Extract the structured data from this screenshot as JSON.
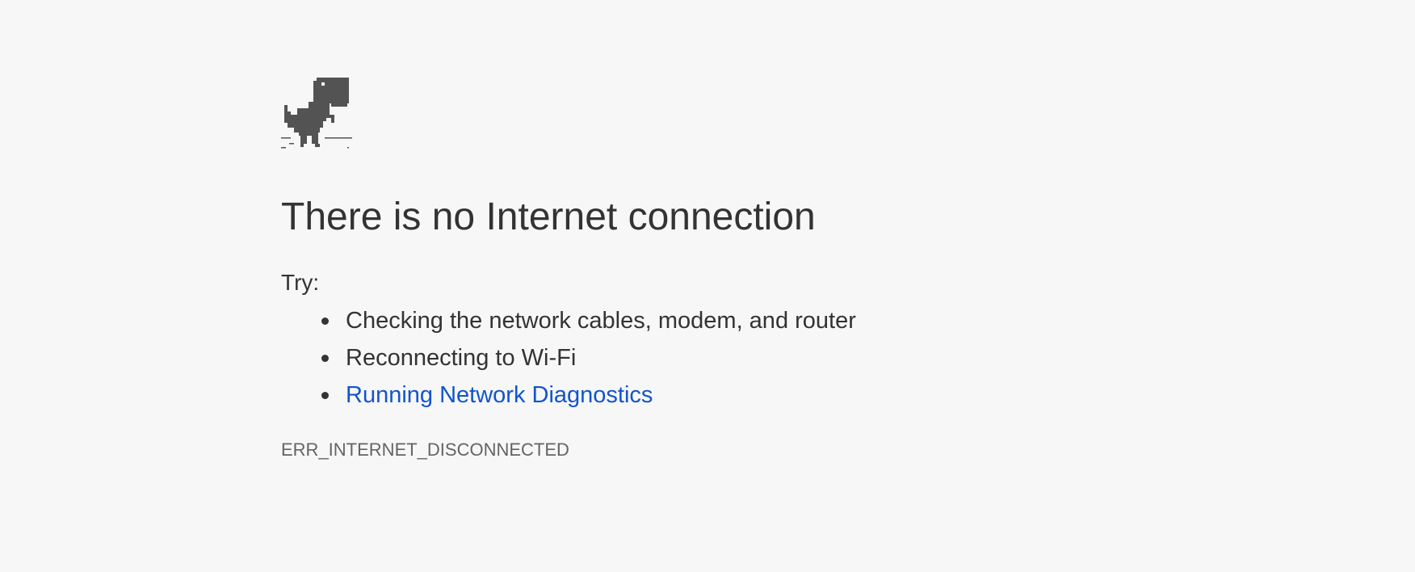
{
  "page": {
    "background_color": "#f7f7f7",
    "link_color": "#1155cc",
    "text_color": "#333333"
  },
  "icon": {
    "name": "offline-dino-icon",
    "color": "#535353"
  },
  "heading": "There is no Internet connection",
  "try_label": "Try:",
  "suggestions": [
    {
      "label": "Checking the network cables, modem, and router",
      "is_link": false
    },
    {
      "label": "Reconnecting to Wi-Fi",
      "is_link": false
    },
    {
      "label": "Running Network Diagnostics",
      "is_link": true
    }
  ],
  "error_code": "ERR_INTERNET_DISCONNECTED"
}
